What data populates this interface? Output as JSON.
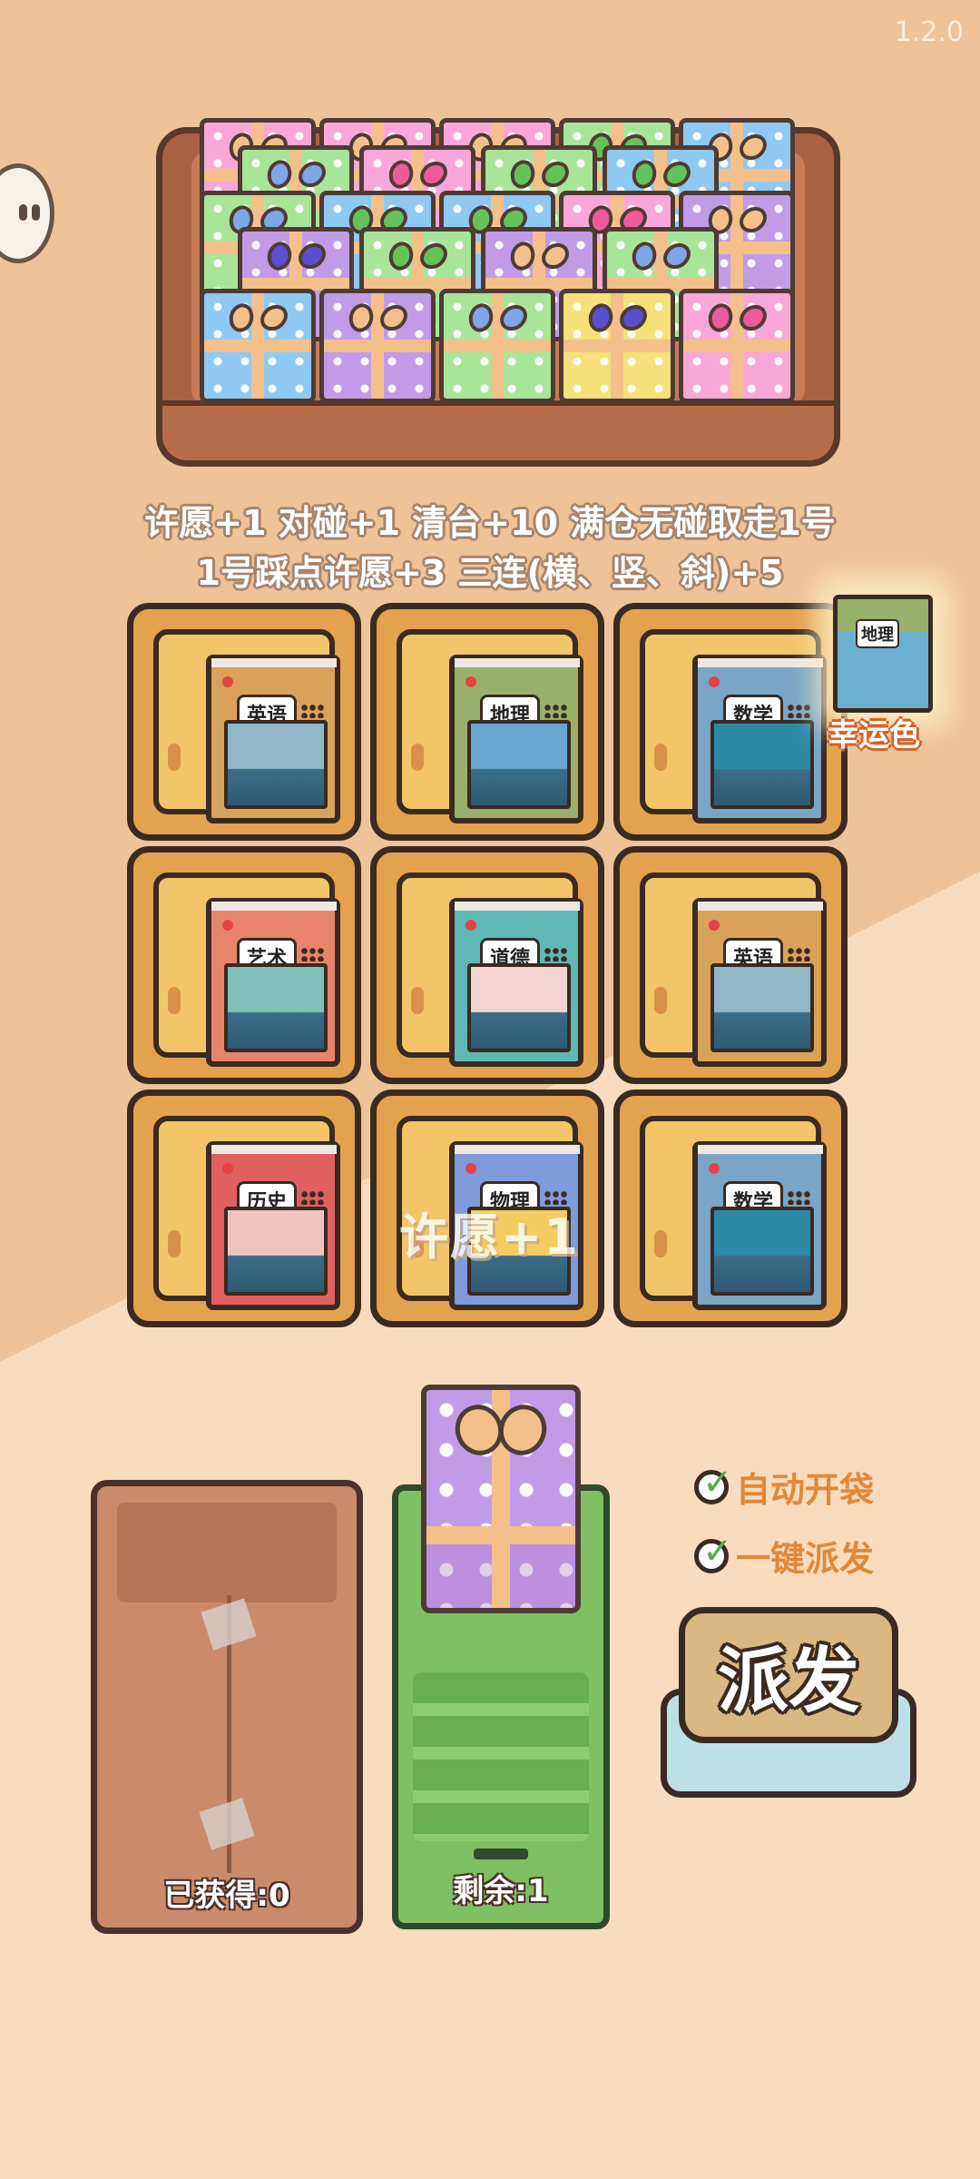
{
  "version": "1.2.0",
  "rules": {
    "line1": "许愿+1 对碰+1 清台+10 满仓无碰取走1号",
    "line2": "1号踩点许愿+3 三连(横、竖、斜)+5"
  },
  "colors": {
    "gift_pink": "#f7a8d8",
    "gift_green": "#a8e59a",
    "gift_blue": "#8fc9f2",
    "gift_purple": "#c29be6",
    "gift_yellow": "#f5e07a",
    "bow_orange": "#f3c08c",
    "bow_pink": "#ef5b9a",
    "bow_blue": "#7fa6e8",
    "bow_indigo": "#5a4fd0",
    "bow_green": "#65c25a"
  },
  "grid": [
    {
      "subject": "英语",
      "cover": "#d9a25a",
      "pic": "#8fb7c8"
    },
    {
      "subject": "地理",
      "cover": "#98b06c",
      "pic": "#6aa7d0"
    },
    {
      "subject": "数学",
      "cover": "#7aa5c6",
      "pic": "#2d8aa6"
    },
    {
      "subject": "艺术",
      "cover": "#e8846c",
      "pic": "#7fc0b8"
    },
    {
      "subject": "道德",
      "cover": "#5fb8b4",
      "pic": "#f4d3d3"
    },
    {
      "subject": "英语",
      "cover": "#d9a25a",
      "pic": "#8fb7c8"
    },
    {
      "subject": "历史",
      "cover": "#e06060",
      "pic": "#f0c3c0"
    },
    {
      "subject": "物理",
      "cover": "#7f9bd9",
      "pic": "#f3cd62"
    },
    {
      "subject": "数学",
      "cover": "#7aa5c6",
      "pic": "#2d8aa6"
    }
  ],
  "floating_text": "许愿+1",
  "lucky": {
    "subject": "地理",
    "label": "幸运色"
  },
  "bags": {
    "obtained_label": "已获得:0",
    "remaining_label": "剩余:1"
  },
  "options": {
    "auto_open": "自动开袋",
    "one_key": "一键派发"
  },
  "dispatch_label": "派发"
}
